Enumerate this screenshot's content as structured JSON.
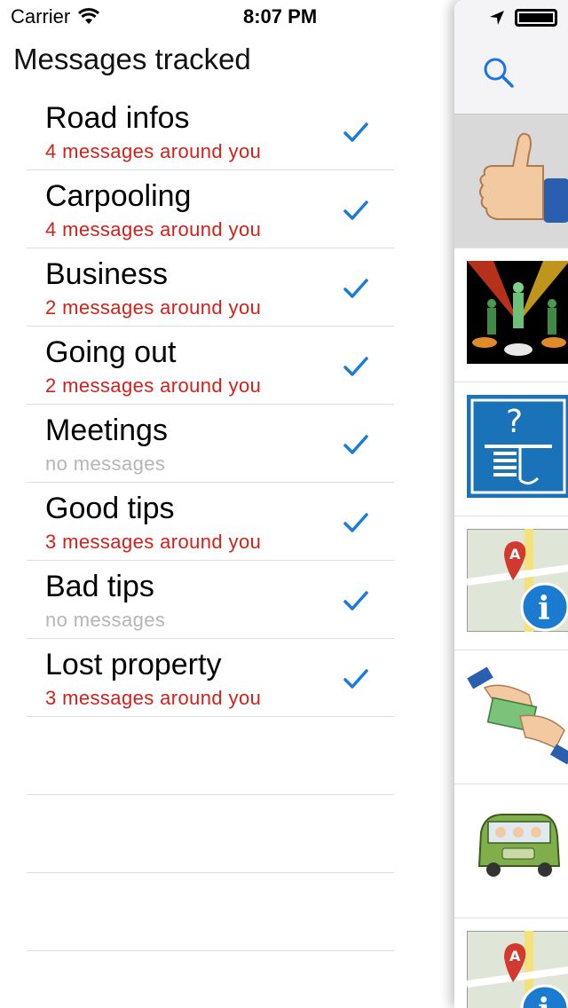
{
  "status_bar": {
    "carrier": "Carrier",
    "time": "8:07 PM"
  },
  "title": "Messages tracked",
  "categories": [
    {
      "name": "Road infos",
      "subtitle": "4 messages around you",
      "state": "red"
    },
    {
      "name": "Carpooling",
      "subtitle": "4 messages around you",
      "state": "red"
    },
    {
      "name": "Business",
      "subtitle": "2 messages around you",
      "state": "red"
    },
    {
      "name": "Going out",
      "subtitle": "2 messages around you",
      "state": "red"
    },
    {
      "name": "Meetings",
      "subtitle": "no messages",
      "state": "grey"
    },
    {
      "name": "Good tips",
      "subtitle": "3 messages around you",
      "state": "red"
    },
    {
      "name": "Bad tips",
      "subtitle": "no messages",
      "state": "grey"
    },
    {
      "name": "Lost property",
      "subtitle": "3 messages around you",
      "state": "red"
    }
  ],
  "colors": {
    "accent": "#1a73e8",
    "check": "#1a7bdb",
    "count_text": "#d0211a",
    "empty_text": "#b5b5b5"
  },
  "peek_panel": {
    "icons": [
      "search-icon",
      "location-arrow-icon",
      "battery-icon"
    ],
    "thumbnails": [
      "thumbs-up-image",
      "dance-party-image",
      "lost-umbrella-sign-image",
      "map-info-image",
      "money-handoff-image",
      "carpool-car-image",
      "map-info-image"
    ]
  }
}
